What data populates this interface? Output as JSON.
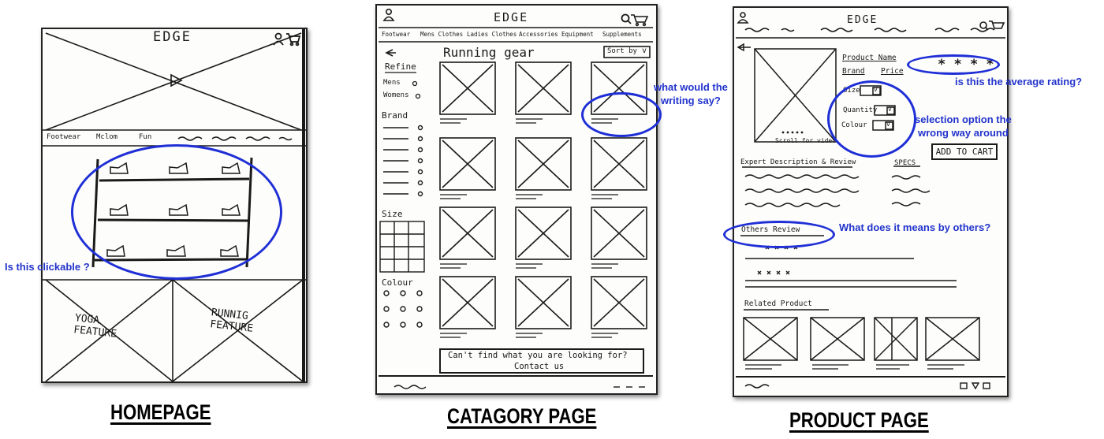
{
  "homepage": {
    "brand": "EDGE",
    "nav_items": [
      "Footwear",
      "Mclom",
      "Fun"
    ],
    "features": [
      "YOGA\nFEATURE",
      "RUNNIG\nFEATURE"
    ],
    "label": "HOMEPAGE",
    "annotation": "Is this clickable ?",
    "icons": [
      "user-icon",
      "cart-icon",
      "play-icon"
    ]
  },
  "category": {
    "brand": "EDGE",
    "nav_items": [
      "Footwear",
      "Mens Clothes",
      "Ladies Clothes",
      "Accessories",
      "Equipment",
      "Supplements"
    ],
    "page_heading": "Running gear",
    "sort_label": "Sort by",
    "refine_label": "Refine",
    "gender_options": [
      "Mens",
      "Womens"
    ],
    "brand_label": "Brand",
    "size_label": "Size",
    "colour_label": "Colour",
    "contact_line1": "Can't find what you are looking for?",
    "contact_line2": "Contact us",
    "annotation": "what would the\nwriting say?",
    "label": "CATAGORY PAGE",
    "icons": [
      "user-icon",
      "search-icon",
      "cart-icon"
    ]
  },
  "product": {
    "brand": "EDGE",
    "product_name": "Product Name",
    "brand_field": "Brand",
    "price_field": "Price",
    "rating": "* * * *",
    "size_label": "Size",
    "quantity_label": "Quantity",
    "colour_label": "Colour",
    "scroll_caption": "Scroll for video",
    "add_to_cart": "ADD TO CART",
    "expert_tab": "Expert Description & Review",
    "specs_tab": "SPECS",
    "others_review": "Others Review",
    "related": "Related Product",
    "annotations": {
      "rating": "is this the average rating?",
      "selection": "selection option the\nwrong way around",
      "others": "What does it means by others?"
    },
    "label": "PRODUCT PAGE",
    "icons": [
      "user-icon",
      "search-icon",
      "cart-icon",
      "back-arrow-icon"
    ]
  },
  "colors": {
    "annotation": "#2233cc",
    "ink": "#1a1a1a",
    "paper": "#fdfdfb"
  }
}
